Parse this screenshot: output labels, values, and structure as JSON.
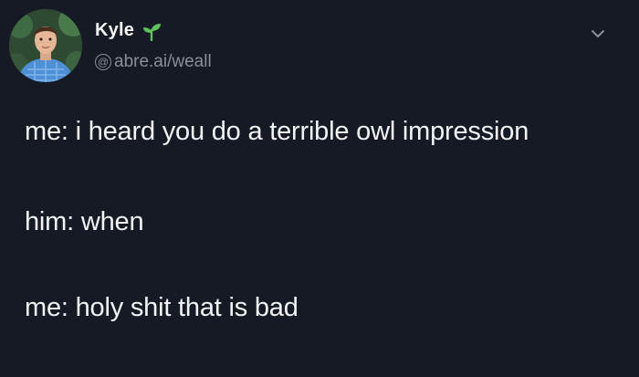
{
  "author": {
    "display_name": "Kyle",
    "handle": "abre.ai/weall"
  },
  "icons": {
    "badge": "sprout-icon",
    "handle_prefix": "at-icon",
    "menu": "chevron-down-icon"
  },
  "colors": {
    "background": "#151a24",
    "text": "#f2f3f5",
    "muted": "#8a8f99",
    "sprout": "#5cc45a"
  },
  "tweet": {
    "lines": [
      "me: i heard you do a terrible owl impression",
      "him: when",
      "me: holy shit that is bad"
    ]
  }
}
